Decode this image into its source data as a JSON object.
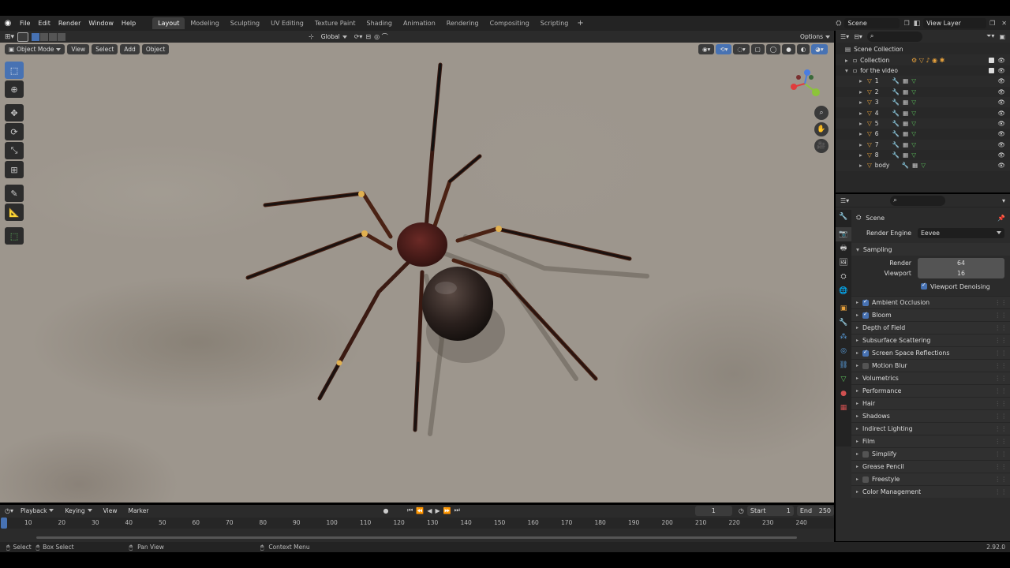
{
  "menu": [
    "File",
    "Edit",
    "Render",
    "Window",
    "Help"
  ],
  "workspaces": [
    "Layout",
    "Modeling",
    "Sculpting",
    "UV Editing",
    "Texture Paint",
    "Shading",
    "Animation",
    "Rendering",
    "Compositing",
    "Scripting"
  ],
  "scene_field": "Scene",
  "view_layer_field": "View Layer",
  "header": {
    "orientation": "Global",
    "options": "Options"
  },
  "viewport_header": {
    "mode": "Object Mode",
    "view": "View",
    "select": "Select",
    "add": "Add",
    "object": "Object"
  },
  "outliner": {
    "root": "Scene Collection",
    "collection": "Collection",
    "for_video": "for the video",
    "items": [
      "1",
      "2",
      "3",
      "4",
      "5",
      "6",
      "7",
      "8",
      "body"
    ]
  },
  "properties": {
    "context": "Scene",
    "render_engine_label": "Render Engine",
    "render_engine_value": "Eevee",
    "sampling": "Sampling",
    "render_label": "Render",
    "render_value": "64",
    "viewport_label": "Viewport",
    "viewport_value": "16",
    "denoise": "Viewport Denoising",
    "panels": [
      {
        "label": "Ambient Occlusion",
        "check": "on"
      },
      {
        "label": "Bloom",
        "check": "on"
      },
      {
        "label": "Depth of Field",
        "check": "none"
      },
      {
        "label": "Subsurface Scattering",
        "check": "none"
      },
      {
        "label": "Screen Space Reflections",
        "check": "on"
      },
      {
        "label": "Motion Blur",
        "check": "off"
      },
      {
        "label": "Volumetrics",
        "check": "none"
      },
      {
        "label": "Performance",
        "check": "none"
      },
      {
        "label": "Hair",
        "check": "none"
      },
      {
        "label": "Shadows",
        "check": "none"
      },
      {
        "label": "Indirect Lighting",
        "check": "none"
      },
      {
        "label": "Film",
        "check": "none"
      },
      {
        "label": "Simplify",
        "check": "off"
      },
      {
        "label": "Grease Pencil",
        "check": "none"
      },
      {
        "label": "Freestyle",
        "check": "off"
      },
      {
        "label": "Color Management",
        "check": "none"
      }
    ]
  },
  "timeline": {
    "playback": "Playback",
    "keying": "Keying",
    "view": "View",
    "marker": "Marker",
    "current_frame": "1",
    "start_label": "Start",
    "start_value": "1",
    "end_label": "End",
    "end_value": "250",
    "ruler": [
      "10",
      "20",
      "30",
      "40",
      "50",
      "60",
      "70",
      "80",
      "90",
      "100",
      "110",
      "120",
      "130",
      "140",
      "150",
      "160",
      "170",
      "180",
      "190",
      "200",
      "210",
      "220",
      "230",
      "240"
    ]
  },
  "status": {
    "select": "Select",
    "box_select": "Box Select",
    "pan_view": "Pan View",
    "context_menu": "Context Menu",
    "version": "2.92.0"
  },
  "colors": {
    "accent": "#4772b3",
    "object_orange": "#e8a23c",
    "mesh_green": "#5bbf5b",
    "panel_bg": "#2b2b2b",
    "header_bg": "#232323"
  }
}
